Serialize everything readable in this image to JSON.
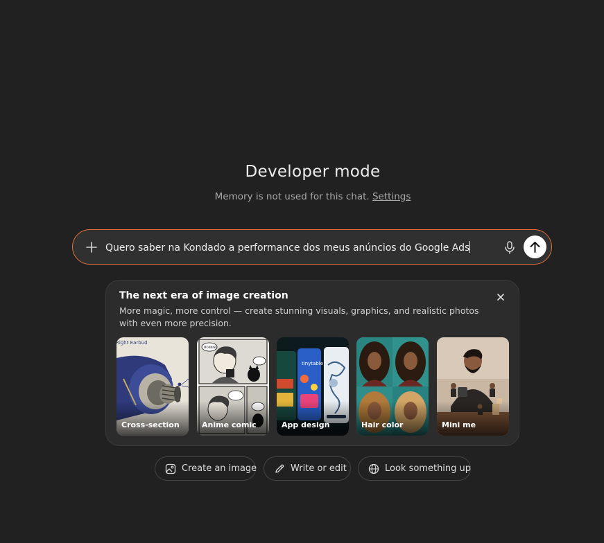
{
  "header": {
    "title": "Developer mode",
    "memory_text": "Memory is not used for this chat.",
    "settings_link": "Settings"
  },
  "composer": {
    "value": "Quero saber na Kondado a performance dos meus anúncios do Google Ads",
    "icons": {
      "add": "plus-icon",
      "mic": "microphone-icon",
      "send": "arrow-up-icon"
    },
    "border_color": "#e0713b"
  },
  "promo": {
    "title": "The next era of image creation",
    "description": "More magic, more control — create stunning visuals, graphics, and realistic photos with even more precision.",
    "tiles": [
      {
        "label": "Cross-section",
        "inner_text": "Right Earbud"
      },
      {
        "label": "Anime comic",
        "inner_text": "MORNING."
      },
      {
        "label": "App design",
        "inner_text": "tinytable"
      },
      {
        "label": "Hair color"
      },
      {
        "label": "Mini me"
      }
    ]
  },
  "actions": [
    {
      "label": "Create an image",
      "icon": "image-icon"
    },
    {
      "label": "Write or edit",
      "icon": "pencil-icon"
    },
    {
      "label": "Look something up",
      "icon": "globe-icon"
    }
  ],
  "colors": {
    "background": "#212121",
    "composer_bg": "#303030",
    "card_bg": "#2c2c2c",
    "accent": "#e0713b"
  }
}
